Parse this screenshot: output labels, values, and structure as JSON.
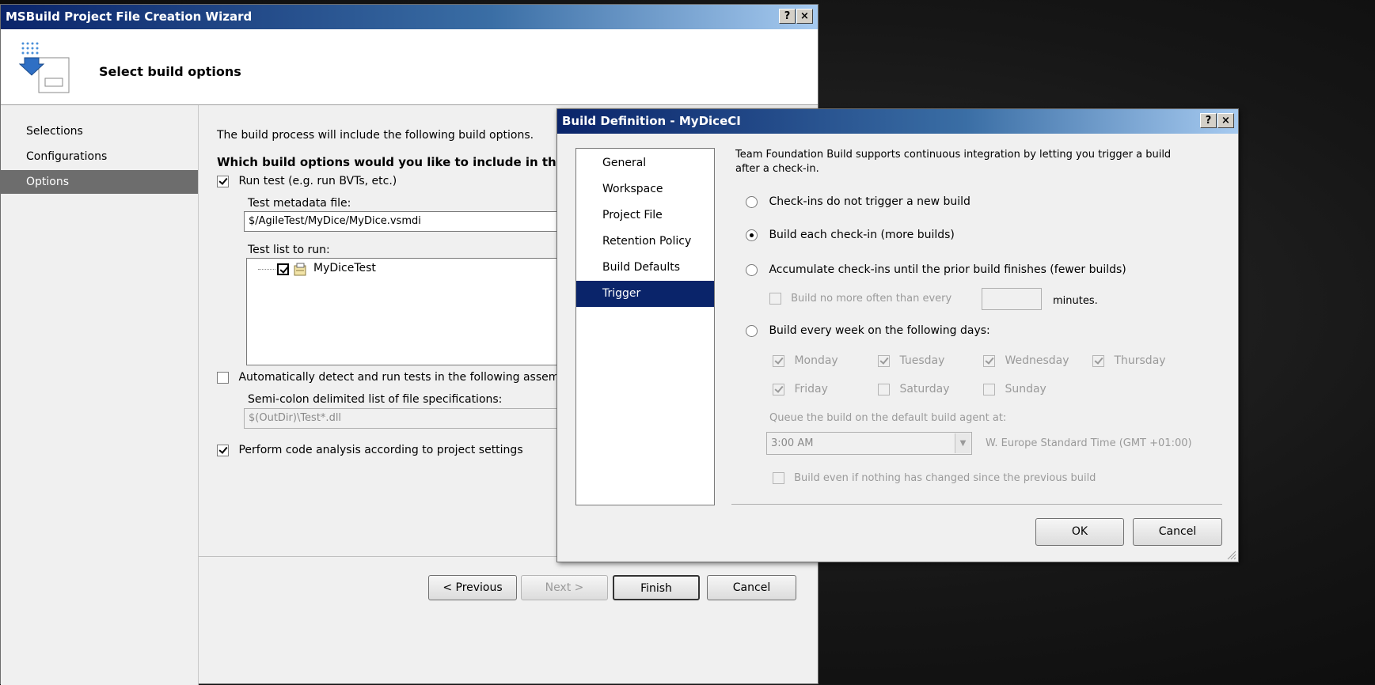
{
  "wizard": {
    "title": "MSBuild Project File Creation Wizard",
    "help_btn": "?",
    "close_btn": "×",
    "header_title": "Select build options",
    "nav": [
      "Selections",
      "Configurations",
      "Options"
    ],
    "intro": "The build process will include the following build options.",
    "question": "Which build options would you like to include in the",
    "run_test_label": "Run test (e.g. run BVTs, etc.)",
    "metadata_label": "Test metadata file:",
    "metadata_value": "$/AgileTest/MyDice/MyDice.vsmdi",
    "testlist_label": "Test list to run:",
    "testlist_item": "MyDiceTest",
    "auto_detect_label": "Automatically detect and run tests in the following assem",
    "semicolon_label": "Semi-colon delimited list of file specifications:",
    "semicolon_value": "$(OutDir)\\Test*.dll",
    "code_analysis_label": "Perform code analysis according to project settings",
    "btn_previous": "< Previous",
    "btn_next": "Next >",
    "btn_finish": "Finish",
    "btn_cancel": "Cancel"
  },
  "builddef": {
    "title": "Build Definition - MyDiceCI",
    "help_btn": "?",
    "close_btn": "×",
    "nav": [
      "General",
      "Workspace",
      "Project File",
      "Retention Policy",
      "Build Defaults",
      "Trigger"
    ],
    "description_line1": "Team Foundation Build supports continuous integration by letting you trigger a build",
    "description_line2": "after a check-in.",
    "opt_no_trigger": "Check-ins do not trigger a new build",
    "opt_each": "Build each check-in (more builds)",
    "opt_accumulate": "Accumulate check-ins until the prior build finishes (fewer builds)",
    "no_more_often": "Build no more often than every",
    "minutes": "minutes.",
    "opt_weekly": "Build every week on the following days:",
    "days": [
      "Monday",
      "Tuesday",
      "Wednesday",
      "Thursday",
      "Friday",
      "Saturday",
      "Sunday"
    ],
    "queue_label": "Queue the build on the default build agent at:",
    "time_value": "3:00 AM",
    "timezone": "W. Europe Standard Time (GMT +01:00)",
    "build_even": "Build even if nothing has changed since the previous build",
    "btn_ok": "OK",
    "btn_cancel": "Cancel"
  }
}
